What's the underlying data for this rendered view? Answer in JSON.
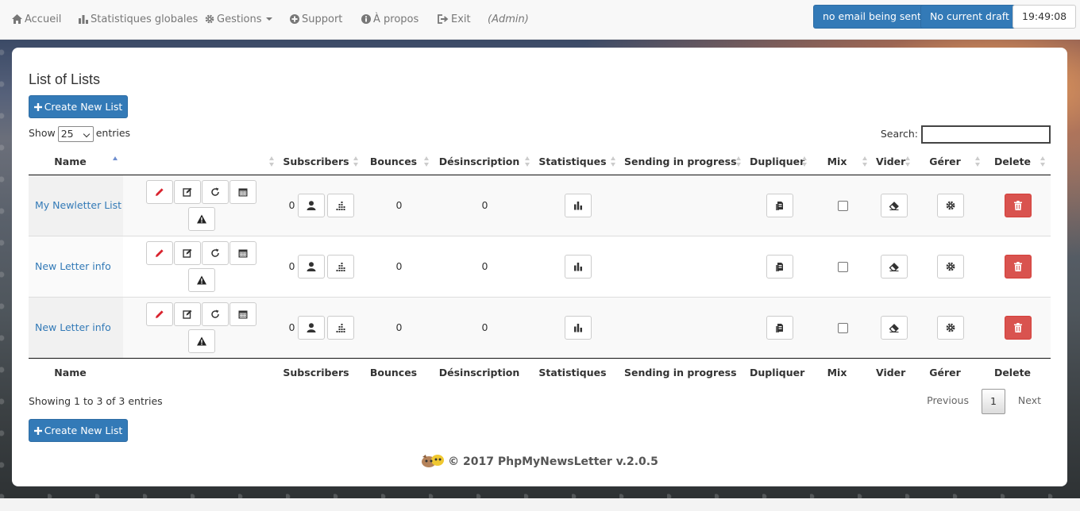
{
  "nav": {
    "home": "Accueil",
    "stats": "Statistiques globales",
    "manage": "Gestions",
    "support": "Support",
    "about": "À propos",
    "exit": "Exit",
    "role": "(Admin)",
    "email_status": "no email being sent",
    "draft_status": "No current draft",
    "clock": "19:49:08"
  },
  "page": {
    "title": "List of Lists",
    "create_button": "Create New List",
    "show_label": "Show",
    "entries_value": "25",
    "entries_label": "entries",
    "search_label": "Search:",
    "search_value": ""
  },
  "table": {
    "columns": [
      "Name",
      "",
      "Subscribers",
      "Bounces",
      "Désinscription",
      "Statistiques",
      "Sending in progress",
      "Dupliquer",
      "Mix",
      "Vider",
      "Gérer",
      "Delete"
    ],
    "rows": [
      {
        "name": "My Newletter List",
        "subscribers": "0",
        "bounces": "0",
        "unsubscribed": "0",
        "mix_checked": false
      },
      {
        "name": "New Letter info",
        "subscribers": "0",
        "bounces": "0",
        "unsubscribed": "0",
        "mix_checked": false
      },
      {
        "name": "New Letter info",
        "subscribers": "0",
        "bounces": "0",
        "unsubscribed": "0",
        "mix_checked": false
      }
    ]
  },
  "footer": {
    "showing": "Showing 1 to 3 of 3 entries",
    "previous": "Previous",
    "page": "1",
    "next": "Next",
    "copyright": "© 2017 PhpMyNewsLetter v.2.0.5"
  },
  "colors": {
    "primary": "#337ab7",
    "danger": "#d9534f",
    "link": "#337ab7"
  }
}
